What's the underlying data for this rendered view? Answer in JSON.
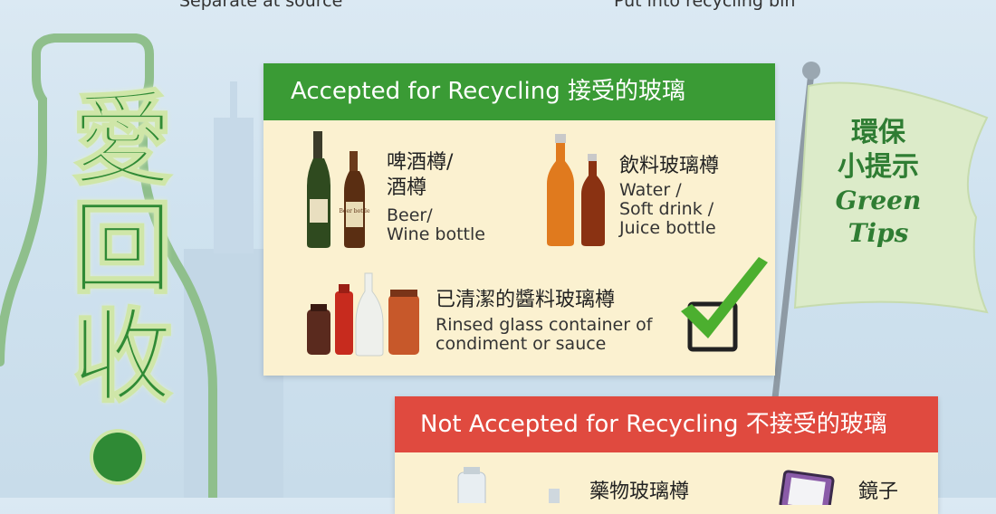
{
  "top_captions": {
    "left": "Separate at source",
    "right": "Put into recycling bin"
  },
  "slogan": {
    "chars": [
      "愛",
      "回",
      "收"
    ]
  },
  "accepted": {
    "title": "Accepted for Recycling 接受的玻璃",
    "items": [
      {
        "zh_line1": "啤酒樽/",
        "zh_line2": "酒樽",
        "en_line1": "Beer/",
        "en_line2": "Wine bottle",
        "icon": "beer-wine-bottles-icon"
      },
      {
        "zh_line1": "飲料玻璃樽",
        "en_line1": "Water /",
        "en_line2": "Soft drink /",
        "en_line3": "Juice bottle",
        "icon": "drink-bottles-icon"
      },
      {
        "zh_line1": "已清潔的醬料玻璃樽",
        "en_line1": "Rinsed glass container of",
        "en_line2": "condiment or sauce",
        "icon": "condiment-jars-icon"
      }
    ],
    "bottle_label": "Beer bottle"
  },
  "rejected": {
    "title": "Not Accepted for Recycling 不接受的玻璃",
    "items": [
      {
        "zh_line1": "藥物玻璃樽",
        "icon": "medicine-bottles-icon"
      },
      {
        "zh_line1": "鏡子",
        "icon": "mirror-icon"
      }
    ]
  },
  "green_tips": {
    "zh_line1": "環保",
    "zh_line2": "小提示",
    "en_line1": "Green",
    "en_line2": "Tips"
  },
  "colors": {
    "accepted_header": "#3a9b35",
    "rejected_header": "#e04a3f",
    "panel_bg": "#fbf1d0",
    "slogan_green": "#2f8a35"
  }
}
